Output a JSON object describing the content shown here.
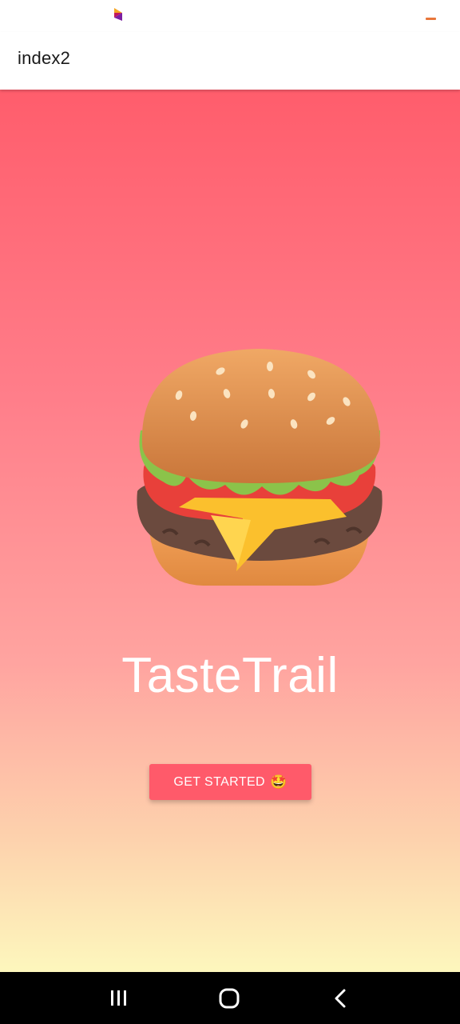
{
  "status_bar": {
    "logo_icon": "carrier-logo-icon",
    "indicator_icon": "minimize-dash-icon"
  },
  "app_bar": {
    "title": "index2"
  },
  "hero": {
    "illustration_icon": "hamburger-icon",
    "brand_name": "TasteTrail",
    "cta_label": "GET STARTED",
    "cta_emoji": "🤩"
  },
  "nav_bar": {
    "recents_icon": "recents-icon",
    "home_icon": "home-icon",
    "back_icon": "back-icon"
  },
  "colors": {
    "accent": "#ff5a6a",
    "gradient_top": "#ff5d6c",
    "gradient_bottom": "#fdf7bd"
  }
}
